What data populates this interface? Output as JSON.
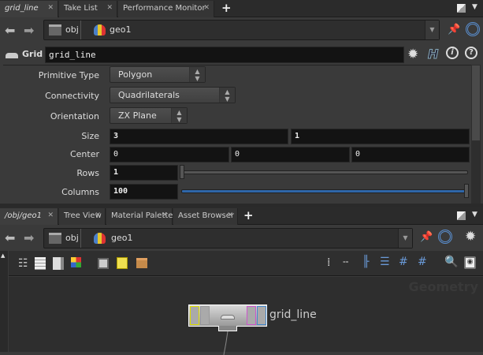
{
  "top_tabs": [
    {
      "label": "grid_line"
    },
    {
      "label": "Take List"
    },
    {
      "label": "Performance Monitor"
    }
  ],
  "top_path": {
    "segments": [
      "obj",
      "geo1"
    ]
  },
  "node_header": {
    "type": "Grid",
    "name": "grid_line"
  },
  "params": {
    "primitive_type": {
      "label": "Primitive Type",
      "value": "Polygon"
    },
    "connectivity": {
      "label": "Connectivity",
      "value": "Quadrilaterals"
    },
    "orientation": {
      "label": "Orientation",
      "value": "ZX Plane"
    },
    "size": {
      "label": "Size",
      "values": [
        "3",
        "1"
      ]
    },
    "center": {
      "label": "Center",
      "values": [
        "0",
        "0",
        "0"
      ]
    },
    "rows": {
      "label": "Rows",
      "value": "1",
      "slider_fraction": 0.0
    },
    "columns": {
      "label": "Columns",
      "value": "100",
      "slider_fraction": 1.0
    }
  },
  "bottom_tabs": [
    {
      "label": "/obj/geo1"
    },
    {
      "label": "Tree View"
    },
    {
      "label": "Material Palette"
    },
    {
      "label": "Asset Browser"
    }
  ],
  "bottom_path": {
    "segments": [
      "obj",
      "geo1"
    ]
  },
  "network": {
    "context_label": "Geometry",
    "node": {
      "name": "grid_line"
    }
  },
  "colors": {
    "accent_blue": "#3d6fb5",
    "input_bg": "#131313"
  }
}
